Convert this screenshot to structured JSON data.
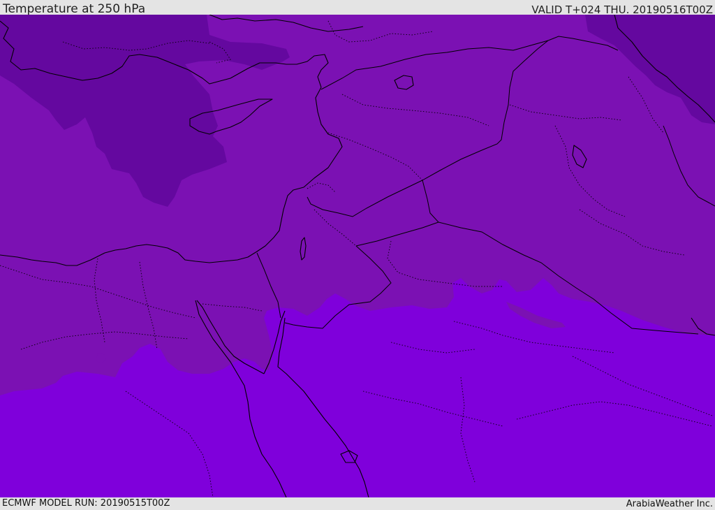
{
  "header": {
    "title": "Temperature at 250 hPa",
    "valid_time": "VALID T+024 THU. 20190516T00Z"
  },
  "footer": {
    "model_run": "ECMWF MODEL RUN: 20190515T00Z",
    "credit": "ArabiaWeather Inc."
  },
  "colors": {
    "band_cold": "#64089f",
    "band_mid": "#7b11b3",
    "band_warm": "#7f00db",
    "borders": "#000000"
  }
}
